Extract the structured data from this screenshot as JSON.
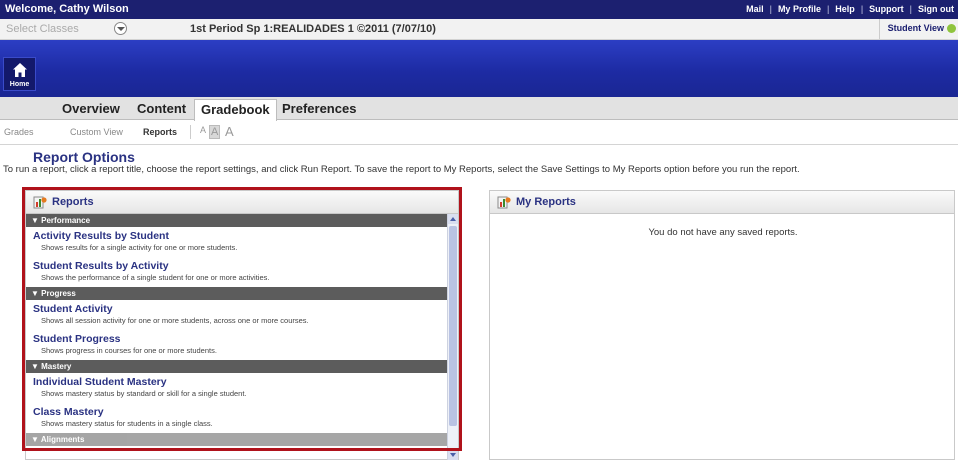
{
  "top_bar": {
    "welcome": "Welcome, Cathy Wilson",
    "links": [
      "Mail",
      "My Profile",
      "Help",
      "Support",
      "Sign out"
    ],
    "separator": "|"
  },
  "class_bar": {
    "select_classes": "Select Classes",
    "course": "1st Period Sp 1:REALIDADES 1 ©2011 (7/07/10)",
    "student_view": "Student View"
  },
  "banner": {
    "home_label": "Home"
  },
  "nav_tabs": [
    {
      "label": "Overview",
      "active": false
    },
    {
      "label": "Content",
      "active": false
    },
    {
      "label": "Gradebook",
      "active": true
    },
    {
      "label": "Preferences",
      "active": false
    }
  ],
  "sub_nav": {
    "items": [
      {
        "label": "Grades",
        "active": false
      },
      {
        "label": "Custom View",
        "active": false
      },
      {
        "label": "Reports",
        "active": true
      }
    ],
    "font_sizes": [
      "A",
      "A",
      "A"
    ]
  },
  "page": {
    "title": "Report Options",
    "instructions": "To run a report, click a report title, choose the report settings, and click Run Report. To save the report to My Reports, select the Save Settings to My Reports option before you run the report."
  },
  "reports_panel": {
    "title": "Reports",
    "sections": [
      {
        "name": "▼ Performance",
        "items": [
          {
            "name": "Activity Results by Student",
            "desc": "Shows results for a single activity for one or more students."
          },
          {
            "name": "Student Results by Activity",
            "desc": "Shows the performance of a single student for one or more activities."
          }
        ]
      },
      {
        "name": "▼ Progress",
        "items": [
          {
            "name": "Student Activity",
            "desc": "Shows all session activity for one or more students, across one or more courses."
          },
          {
            "name": "Student Progress",
            "desc": "Shows progress in courses for one or more students."
          }
        ]
      },
      {
        "name": "▼ Mastery",
        "items": [
          {
            "name": "Individual Student Mastery",
            "desc": "Shows mastery status by standard or skill for a single student."
          },
          {
            "name": "Class Mastery",
            "desc": "Shows mastery status for students in a single class."
          }
        ]
      },
      {
        "name": "▼ Alignments",
        "items": []
      }
    ]
  },
  "my_reports_panel": {
    "title": "My Reports",
    "empty_message": "You do not have any saved reports."
  },
  "colors": {
    "top_bar": "#1c2070",
    "banner": "#2a3cc0",
    "link": "#2a3282",
    "section_header": "#5c5c5c",
    "highlight_outline": "#b0121b"
  }
}
